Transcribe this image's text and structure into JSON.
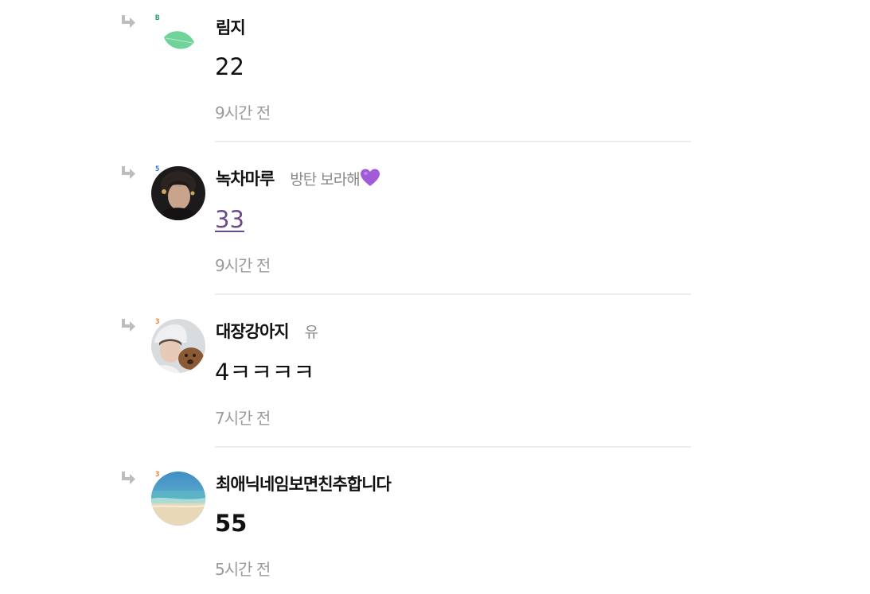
{
  "comments": [
    {
      "nickname": "림지",
      "status": "",
      "content": "22",
      "time": "9시간 전",
      "level_badge": "B",
      "badge_color": "#10a060",
      "avatar_icon": "leaf-icon"
    },
    {
      "nickname": "녹차마루",
      "status": "방탄 보라해",
      "content": "33",
      "time": "9시간 전",
      "level_badge": "5",
      "badge_color": "#2a6fd6",
      "avatar_icon": "profile-photo",
      "status_icon": "purple-heart-icon"
    },
    {
      "nickname": "대장강아지",
      "status": "유",
      "content": "4ㅋㅋㅋㅋ",
      "time": "7시간 전",
      "level_badge": "3",
      "badge_color": "#f07830",
      "avatar_icon": "profile-photo"
    },
    {
      "nickname": "최애닉네임보면친추합니다",
      "status": "",
      "content": "55",
      "time": "5시간 전",
      "level_badge": "3",
      "badge_color": "#f07830",
      "avatar_icon": "beach-photo"
    }
  ]
}
